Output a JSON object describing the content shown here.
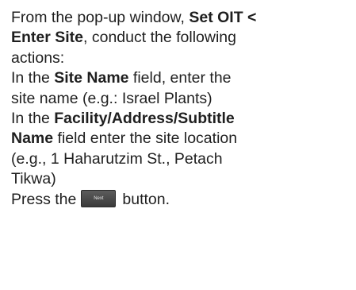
{
  "instructions": {
    "line1_prefix": "From the pop-up window, ",
    "line1_bold": "Set OIT <",
    "line2_bold": "Enter Site",
    "line2_suffix": ", conduct the following",
    "line3": "actions:",
    "line4_prefix": "In the ",
    "line4_bold": "Site Name",
    "line4_suffix": " field, enter the",
    "line5": "site name (e.g.: Israel Plants)",
    "line6_prefix": "In the ",
    "line6_bold": "Facility/Address/Subtitle",
    "line7_bold": "Name",
    "line7_suffix": " field enter the site location",
    "line8": "(e.g., 1 Haharutzim St., Petach",
    "line9": "Tikwa)",
    "line10_prefix": "Press the",
    "line10_suffix": "button.",
    "next_button_label": "Next"
  }
}
